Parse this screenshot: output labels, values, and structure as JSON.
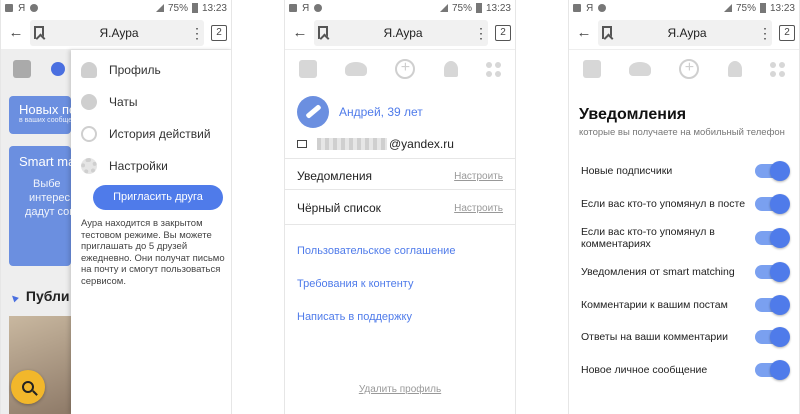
{
  "status": {
    "battery": "75%",
    "time": "13:23",
    "carrier": "Я"
  },
  "browser": {
    "title": "Я.Аура",
    "tab_count": "2"
  },
  "screen1": {
    "bg_card1": {
      "title": "Новых по",
      "sub": "в ваших сообще"
    },
    "bg_card2": {
      "title": "Smart ma",
      "lines": [
        "Выбе",
        "интерес",
        "дадут согла"
      ]
    },
    "bg_public": "Публи",
    "menu": [
      {
        "label": "Профиль",
        "icon": "person-icon"
      },
      {
        "label": "Чаты",
        "icon": "chat-icon"
      },
      {
        "label": "История действий",
        "icon": "history-icon"
      },
      {
        "label": "Настройки",
        "icon": "gear-icon"
      }
    ],
    "invite_label": "Пригласить друга",
    "note": "Аура находится в закрытом тестовом режиме. Вы можете приглашать до 5 друзей ежедневно. Они получат письмо на почту и смогут пользоваться сервисом."
  },
  "screen2": {
    "name": "Андрей, 39 лет",
    "email_domain": "@yandex.ru",
    "rows": [
      {
        "label": "Уведомления",
        "action": "Настроить"
      },
      {
        "label": "Чёрный список",
        "action": "Настроить"
      }
    ],
    "links": [
      "Пользовательское соглашение",
      "Требования к контенту",
      "Написать в поддержку"
    ],
    "delete_label": "Удалить профиль"
  },
  "screen3": {
    "title": "Уведомления",
    "subtitle": "которые вы получаете на мобильный телефон",
    "items": [
      {
        "label": "Новые подписчики",
        "on": true
      },
      {
        "label": "Если вас кто-то упомянул в посте",
        "on": true
      },
      {
        "label": "Если вас кто-то упомянул в комментариях",
        "on": true
      },
      {
        "label": "Уведомления от smart matching",
        "on": true
      },
      {
        "label": "Комментарии к вашим постам",
        "on": true
      },
      {
        "label": "Ответы на ваши комментарии",
        "on": true
      },
      {
        "label": "Новое личное сообщение",
        "on": true
      }
    ]
  },
  "colors": {
    "accent": "#4f7bea"
  }
}
